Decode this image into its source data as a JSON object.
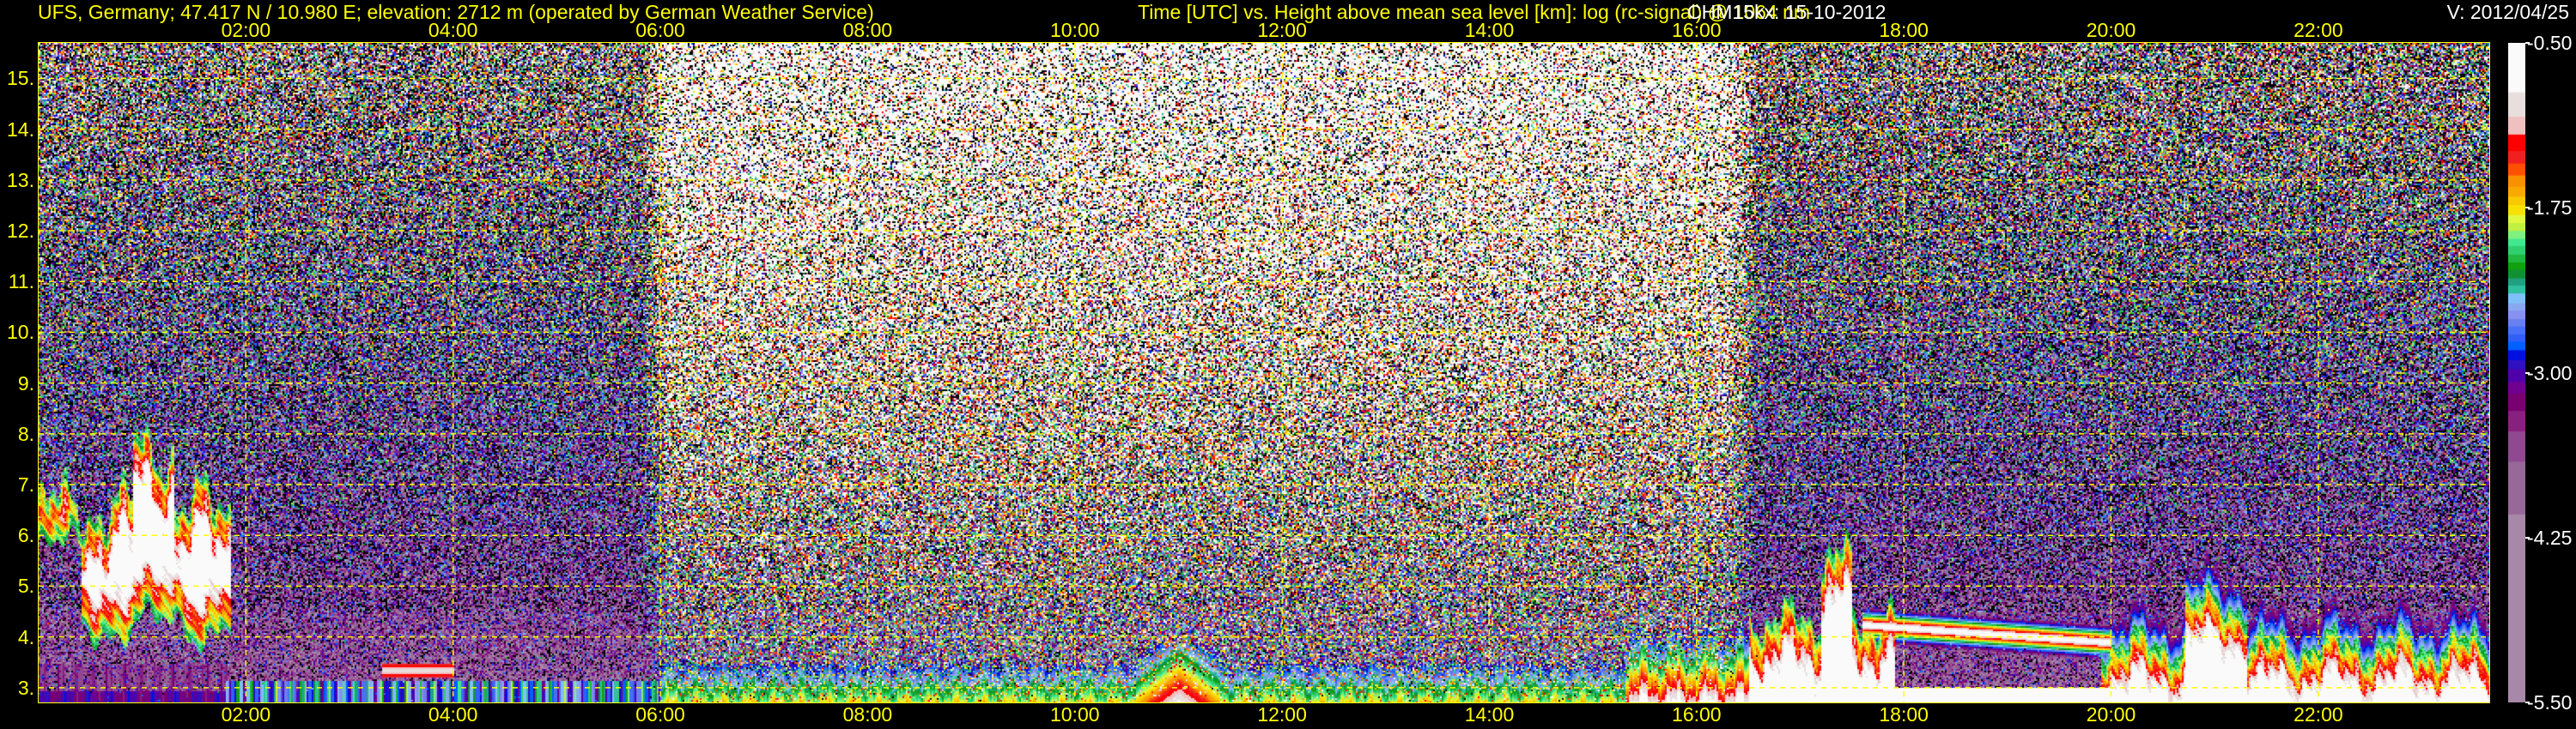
{
  "header": {
    "station": "UFS, Germany; 47.417 N / 10.980 E; elevation: 2712 m  (operated by German Weather Service)",
    "description": "Time [UTC] vs. Height above mean sea level [km]: log (rc-signal) @ 1064 nm",
    "instrument": "CHM15kx: 15-10-2012",
    "version": "V: 2012/04/25"
  },
  "chart_data": {
    "type": "heatmap",
    "title": "Time [UTC] vs. Height above mean sea level [km]: log (rc-signal) @ 1064 nm",
    "xlabel": "Time [UTC]",
    "ylabel": "Height above mean sea level [km]",
    "xlim_hours": [
      0,
      23.65
    ],
    "ylim_km": [
      2.71,
      15.7
    ],
    "x_ticks": [
      "02:00",
      "04:00",
      "06:00",
      "08:00",
      "10:00",
      "12:00",
      "14:00",
      "16:00",
      "18:00",
      "20:00",
      "22:00"
    ],
    "x_tick_hours": [
      2,
      4,
      6,
      8,
      10,
      12,
      14,
      16,
      18,
      20,
      22
    ],
    "y_ticks": [
      "3.",
      "4.",
      "5.",
      "6.",
      "7.",
      "8.",
      "9.",
      "10.",
      "11.",
      "12.",
      "13.",
      "14.",
      "15."
    ],
    "y_tick_km": [
      3,
      4,
      5,
      6,
      7,
      8,
      9,
      10,
      11,
      12,
      13,
      14,
      15
    ],
    "grid": true,
    "grid_color": "#ffff00",
    "colorbar": {
      "range": [
        -5.5,
        -0.5
      ],
      "labels": [
        "-0.50",
        "-1.75",
        "-3.00",
        "-4.25",
        "-5.50"
      ],
      "label_values": [
        -0.5,
        -1.75,
        -3.0,
        -4.25,
        -5.5
      ],
      "colors_top_to_bottom": [
        "#fafafa",
        "#e8dede",
        "#f0c0c0",
        "#ff0000",
        "#f02020",
        "#ff5000",
        "#f89000",
        "#f8a800",
        "#f8c800",
        "#f8e000",
        "#e0f840",
        "#c0f040",
        "#80f080",
        "#40e890",
        "#30d070",
        "#20b840",
        "#10a010",
        "#109030",
        "#20a080",
        "#30c0a0",
        "#80c0f8",
        "#88a8f0",
        "#8890f0",
        "#6880f0",
        "#4870f8",
        "#3060f8",
        "#0060ff",
        "#0010e0",
        "#3010c0",
        "#5000a8",
        "#700090",
        "#780070",
        "#882080",
        "#904890",
        "#986898",
        "#a888a8"
      ]
    },
    "features": [
      {
        "desc_time": "00:00-01:50",
        "height_km": "4.0-8.8",
        "signal": "high (cloud)"
      },
      {
        "desc_time": "16:40-17:40",
        "height_km": "3.0-5.2",
        "signal": "high (cloud)"
      },
      {
        "desc_time": "17:40-20:00",
        "height_km": "3.9-4.3",
        "signal": "high (cloud layer)"
      },
      {
        "desc_time": "20:00-23:40",
        "height_km": "2.8-4.6",
        "signal": "high (boundary layer)"
      }
    ]
  }
}
